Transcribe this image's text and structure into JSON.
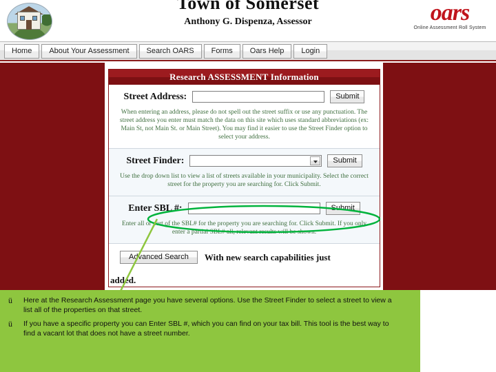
{
  "header": {
    "town_title": "Town of Somerset",
    "assessor": "Anthony G. Dispenza, Assessor",
    "logo_word": "oars",
    "logo_sub": "Online Assessment Roll System"
  },
  "nav": {
    "items": [
      {
        "label": "Home"
      },
      {
        "label": "About Your Assessment"
      },
      {
        "label": "Search OARS"
      },
      {
        "label": "Forms"
      },
      {
        "label": "Oars Help"
      },
      {
        "label": "Login"
      }
    ]
  },
  "panel": {
    "title": "Research ASSESSMENT Information",
    "street_address": {
      "label": "Street Address:",
      "value": "",
      "placeholder": "",
      "submit_label": "Submit",
      "help": "When entering an address, please do not spell out the street suffix or use any punctuation. The street address you enter must match the data on this site which uses standard abbreviations (ex: Main St, not Main St. or Main Street). You may find it easier to use the Street Finder option to select your address."
    },
    "street_finder": {
      "label": "Street Finder:",
      "value": "",
      "submit_label": "Submit",
      "help": "Use the drop down list to view a list of streets available in your municipality. Select the correct street for the property you are searching for. Click Submit."
    },
    "sbl": {
      "label": "Enter SBL #:",
      "value": "",
      "submit_label": "Submit",
      "help": "Enter all or part of the SBL# for the property you are searching for. Click Submit. If you only enter a partial SBL# all, relevant results will be shown."
    },
    "advanced": {
      "button_label": "Advanced Search",
      "text": "With new search capabilities just",
      "text2": "added."
    }
  },
  "callout": {
    "items": [
      {
        "bullet": "ü",
        "text": "Here at the Research Assessment page you have several options. Use the Street Finder to select a street to view a list all of the properties on that street."
      },
      {
        "bullet": "ü",
        "text": "If you have a specific property you can Enter SBL #, which you can find on your tax bill. This tool is the best way to find a vacant lot that does not have a street number."
      }
    ]
  },
  "colors": {
    "brand_red": "#7e1013",
    "logo_red": "#c0141c",
    "callout_green": "#8ec63f",
    "annotation_green": "#00b33c",
    "help_text": "#3f6f3f"
  }
}
